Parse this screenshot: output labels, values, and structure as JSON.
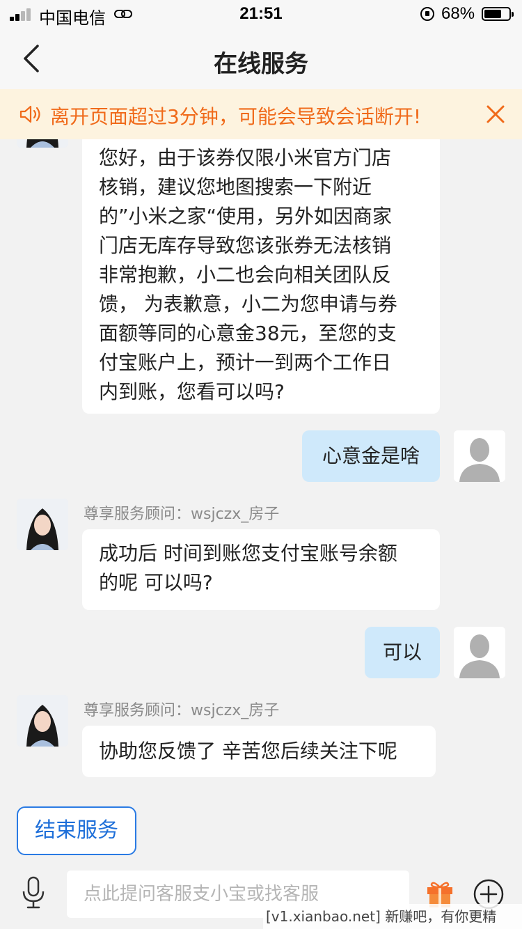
{
  "status_bar": {
    "carrier": "中国电信",
    "time": "21:51",
    "battery": "68%"
  },
  "nav": {
    "title": "在线服务"
  },
  "notice": {
    "text": "离开页面超过3分钟，可能会导致会话断开!",
    "color": "#f06a1a"
  },
  "messages": [
    {
      "from": "agent",
      "lines": [
        "您好，由于该券仅限小米官方门店",
        "核销，建议您地图搜索一下附近",
        "的”小米之家“使用，另外如因商家",
        "门店无库存导致您该张券无法核销",
        "非常抱歉，小二也会向相关团队反",
        "馈， 为表歉意，小二为您申请与券",
        "面额等同的心意金38元，至您的支",
        "付宝账户上，预计一到两个工作日",
        "内到账，您看可以吗?"
      ]
    },
    {
      "from": "user",
      "text": "心意金是啥"
    },
    {
      "from": "agent",
      "name": "尊享服务顾问：wsjczx_房子",
      "lines": [
        "成功后 时间到账您支付宝账号余额",
        "的呢 可以吗?"
      ]
    },
    {
      "from": "user",
      "text": "可以"
    },
    {
      "from": "agent",
      "name": "尊享服务顾问：wsjczx_房子",
      "lines": [
        "协助您反馈了 辛苦您后续关注下呢"
      ]
    }
  ],
  "end_service": {
    "label": "结束服务"
  },
  "input": {
    "placeholder": "点此提问客服支小宝或找客服"
  },
  "watermark": "[v1.xianbao.net] 新赚吧，有你更精彩！",
  "icons": {
    "back": "chevron-left-icon",
    "speaker": "speaker-icon",
    "close": "close-icon",
    "mic": "microphone-icon",
    "gift": "gift-icon",
    "plus": "plus-circle-icon"
  },
  "colors": {
    "accent": "#1e6fd9",
    "user_bubble": "#cfe9fb",
    "notice_bg": "#fdf3df"
  }
}
